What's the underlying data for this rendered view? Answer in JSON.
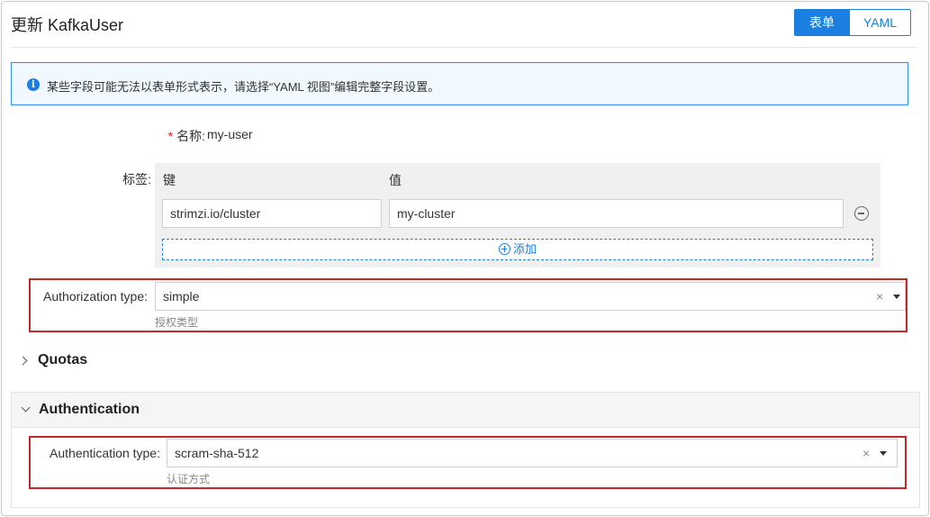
{
  "header": {
    "title": "更新 KafkaUser",
    "mode_form": "表单",
    "mode_yaml": "YAML"
  },
  "alert": {
    "icon": "info-icon",
    "text": "某些字段可能无法以表单形式表示，请选择“YAML 视图”编辑完整字段设置。"
  },
  "name_field": {
    "required_mark": "*",
    "label": "名称:",
    "value": "my-user"
  },
  "labels_field": {
    "label": "标签:",
    "key_header": "键",
    "value_header": "值",
    "rows": [
      {
        "key": "strimzi.io/cluster",
        "value": "my-cluster"
      }
    ],
    "add_label": "添加"
  },
  "authorization": {
    "label": "Authorization type:",
    "value": "simple",
    "clear": "×",
    "help": "授权类型"
  },
  "quotas": {
    "title": "Quotas",
    "expanded": false
  },
  "authentication": {
    "title": "Authentication",
    "expanded": true,
    "label": "Authentication type:",
    "value": "scram-sha-512",
    "clear": "×",
    "help": "认证方式"
  },
  "colors": {
    "primary": "#1a7fe0",
    "highlight_border": "#c0282c",
    "alert_bg": "#f2f8ff"
  }
}
